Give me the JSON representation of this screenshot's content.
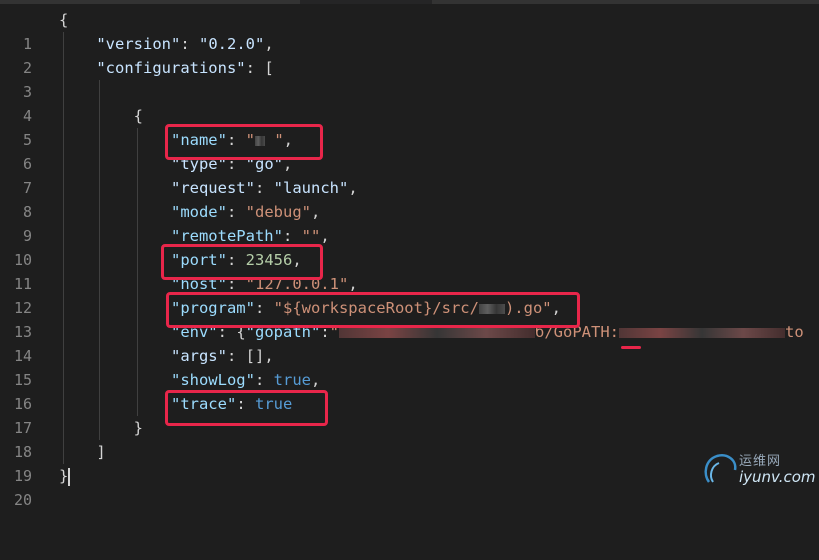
{
  "editor": {
    "line_numbers": [
      "1",
      "2",
      "3",
      "4",
      "5",
      "6",
      "7",
      "8",
      "9",
      "10",
      "11",
      "12",
      "13",
      "14",
      "15",
      "16",
      "17",
      "18",
      "19",
      "20"
    ],
    "open_brace": "{",
    "close_brace": "}",
    "version_key": "\"version\"",
    "version_value": "\"0.2.0\"",
    "configurations_key": "\"configurations\"",
    "array_open": "[",
    "array_close": "]",
    "object_open": "{",
    "object_close": "}",
    "name_key": "\"name\"",
    "name_value_open": "\"",
    "name_value_close": " \"",
    "type_key": "\"type\"",
    "type_value": "\"go\"",
    "request_key": "\"request\"",
    "request_value": "\"launch\"",
    "mode_key": "\"mode\"",
    "mode_value": "\"debug\"",
    "remotePath_key": "\"remotePath\"",
    "remotePath_value": "\"\"",
    "port_key": "\"port\"",
    "port_value": "23456",
    "host_key": "\"host\"",
    "host_value": "\"127.0.0.1\"",
    "program_key": "\"program\"",
    "program_value_start": "\"${workspaceRoot}/src/",
    "program_value_end": ").go\"",
    "env_key": "\"env\"",
    "env_open": "{",
    "gopath_key": "\"gopath\"",
    "gopath_fragment": "б/GoPATH:",
    "gopath_tail": "to",
    "args_key": "\"args\"",
    "args_value": "[]",
    "showLog_key": "\"showLog\"",
    "showLog_value": "true",
    "trace_key": "\"trace\"",
    "trace_value": "true"
  },
  "colors": {
    "highlight_box": "#e8264a",
    "key": "#9cdcfe",
    "string": "#ce9178",
    "number": "#b5cea8",
    "boolean": "#569cd6"
  },
  "watermark": {
    "cn_text": "运维网",
    "domain_text": "iyunv.com"
  }
}
